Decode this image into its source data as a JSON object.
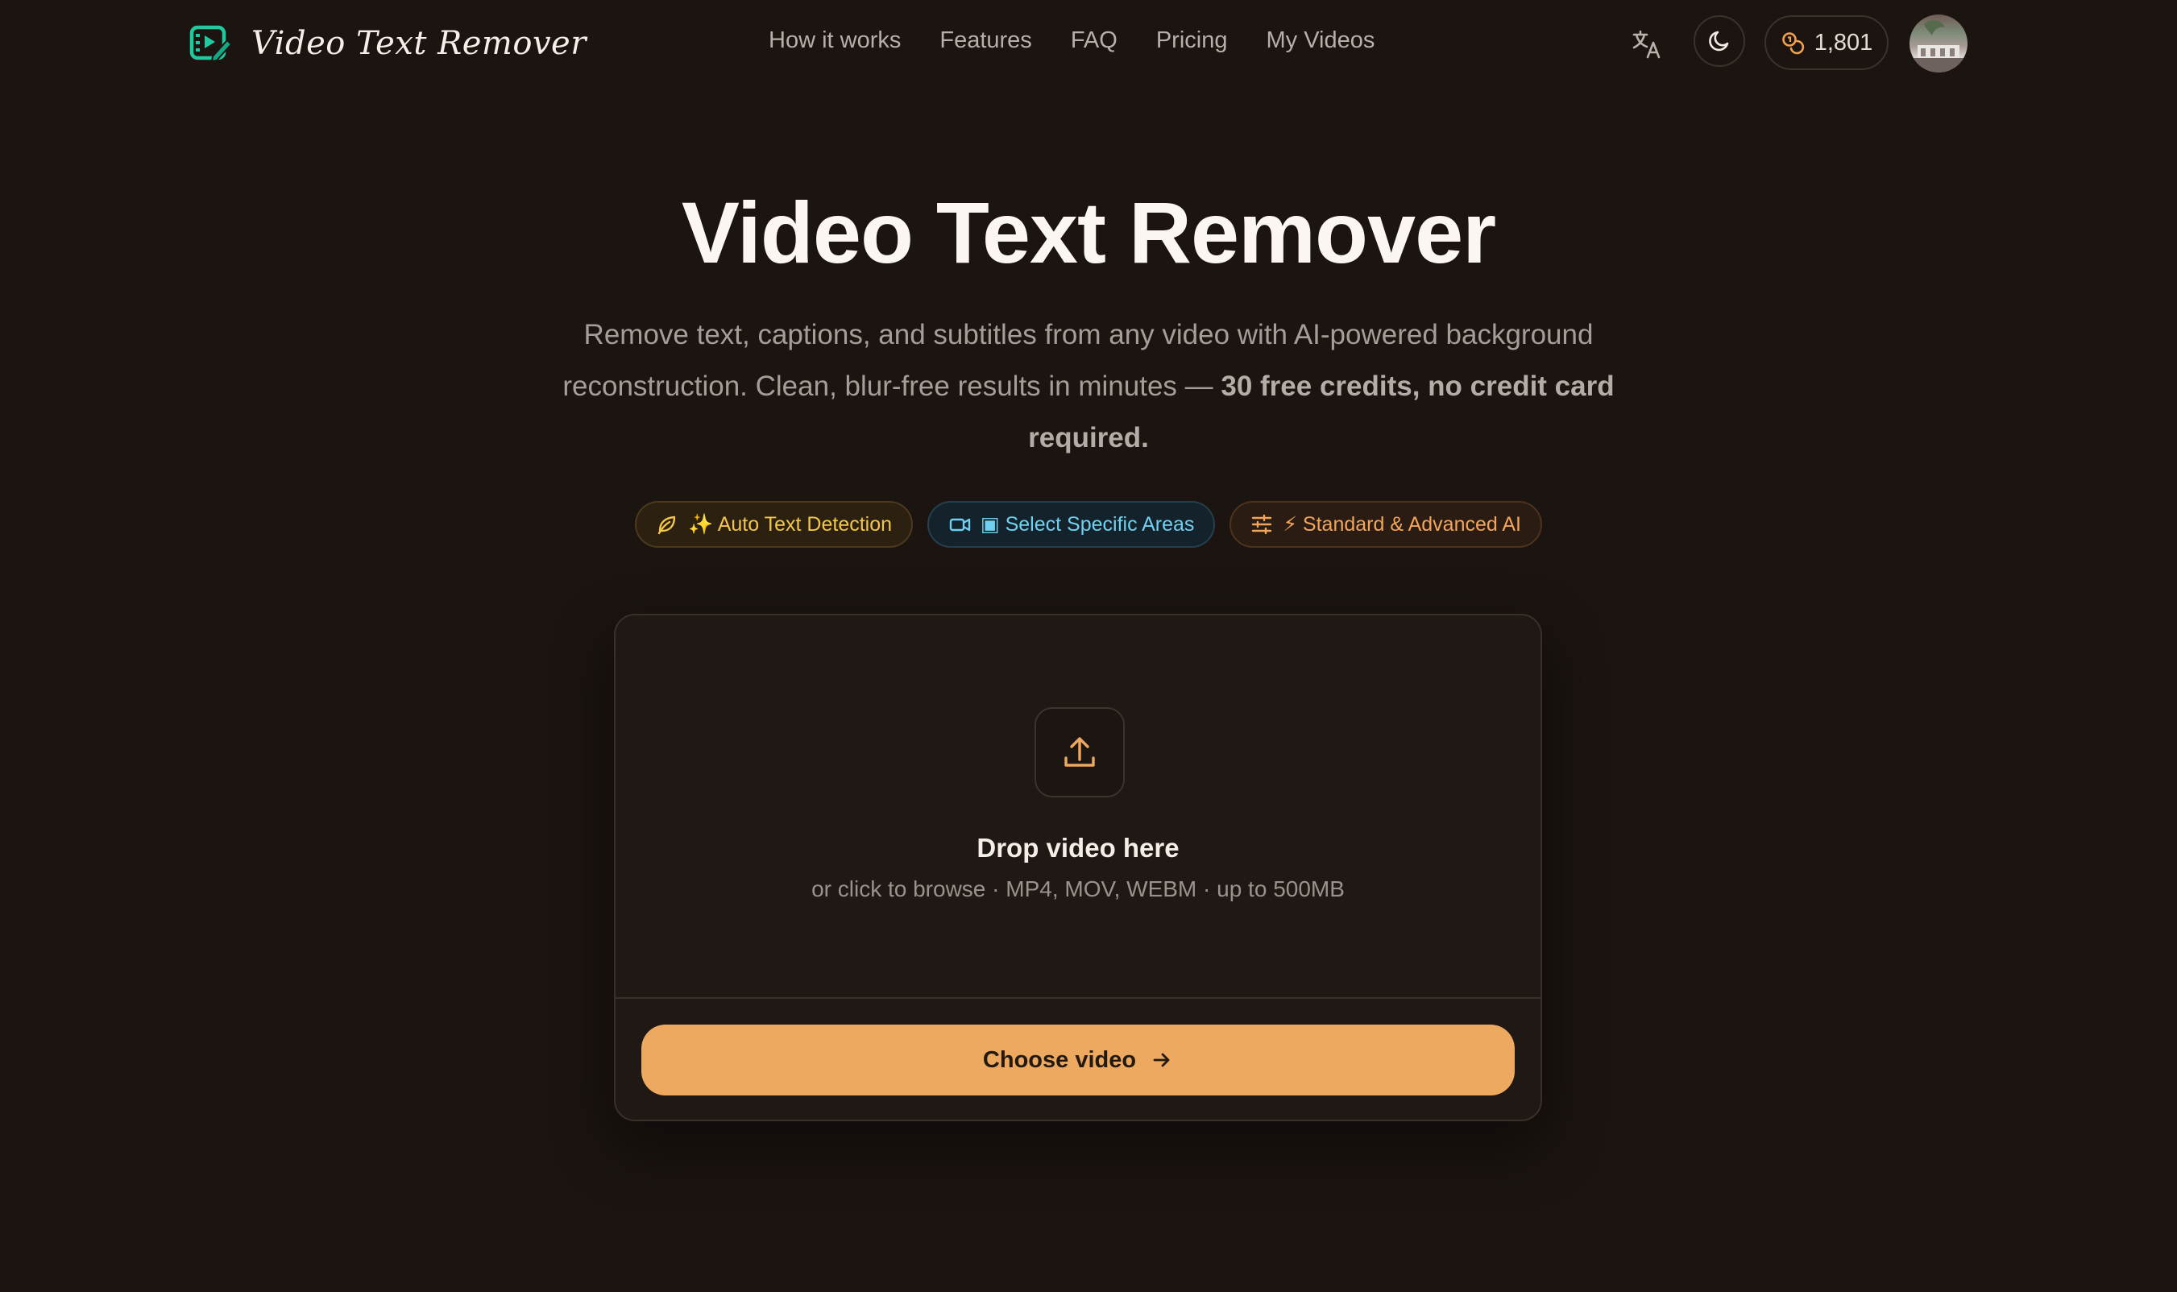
{
  "brand": {
    "name": "Video Text Remover"
  },
  "nav": [
    {
      "label": "How it works"
    },
    {
      "label": "Features"
    },
    {
      "label": "FAQ"
    },
    {
      "label": "Pricing"
    },
    {
      "label": "My Videos"
    }
  ],
  "header": {
    "credits": "1,801"
  },
  "hero": {
    "title": "Video Text Remover",
    "subtitle": "Remove text, captions, and subtitles from any video with AI-powered background reconstruction. Clean, blur-free results in minutes — ",
    "subtitle_bold": "30 free credits, no credit card required."
  },
  "features": [
    {
      "label": "✨ Auto Text Detection",
      "icon": "leaf-icon",
      "color": "#f2c64a"
    },
    {
      "label": "▣ Select Specific Areas",
      "icon": "video-camera-icon",
      "color": "#6fd0f0"
    },
    {
      "label": "⚡ Standard & Advanced AI",
      "icon": "sliders-icon",
      "color": "#f2a55a"
    }
  ],
  "upload": {
    "title": "Drop video here",
    "hint": "or click to browse · MP4, MOV, WEBM · up to 500MB",
    "button": "Choose video"
  },
  "colors": {
    "background": "#1b1410",
    "accent": "#eca95f",
    "brand_icon": "#20c9a0"
  }
}
